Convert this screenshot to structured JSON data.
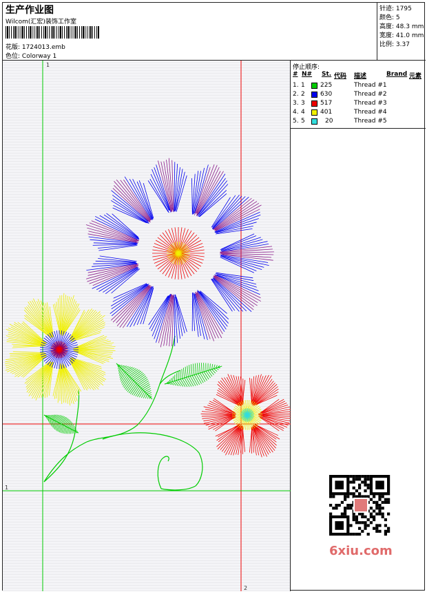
{
  "header": {
    "title": "生产作业图",
    "studio": "Wilcom(汇宏)装饰工作室",
    "design_label": "花版:",
    "design_file": "1724013.emb",
    "colorway_label": "色位:",
    "colorway": "Colorway 1"
  },
  "stats": [
    {
      "label": "针迹:",
      "value": "1795"
    },
    {
      "label": "颜色:",
      "value": "5"
    },
    {
      "label": "高度:",
      "value": "48.3 mm"
    },
    {
      "label": "宽度:",
      "value": "41.0 mm"
    },
    {
      "label": "比例:",
      "value": "3.37"
    }
  ],
  "stop_sequence": {
    "title": "停止顺序:",
    "columns": [
      "#",
      "N#",
      "St.",
      "代码",
      "描述",
      "Brand",
      "元素"
    ],
    "rows": [
      {
        "idx": "1.",
        "n": "1",
        "color": "#00cc00",
        "st": "225",
        "desc": "Thread #1"
      },
      {
        "idx": "2.",
        "n": "2",
        "color": "#0000ee",
        "st": "630",
        "desc": "Thread #2"
      },
      {
        "idx": "3.",
        "n": "3",
        "color": "#ee0000",
        "st": "517",
        "desc": "Thread #3"
      },
      {
        "idx": "4.",
        "n": "4",
        "color": "#f0f000",
        "st": "401",
        "desc": "Thread #4"
      },
      {
        "idx": "5.",
        "n": "5",
        "color": "#33dddd",
        "st": "20",
        "desc": "Thread #5"
      }
    ]
  },
  "guides": {
    "v1": "1",
    "v2": "2",
    "h1": "1"
  },
  "watermark": "6xiu.com",
  "colors": {
    "green": "#00cc00",
    "blue": "#0000ee",
    "red": "#ee0000",
    "yellow": "#f0f000",
    "cyan": "#33dddd",
    "purple": "#8a1a8a"
  }
}
